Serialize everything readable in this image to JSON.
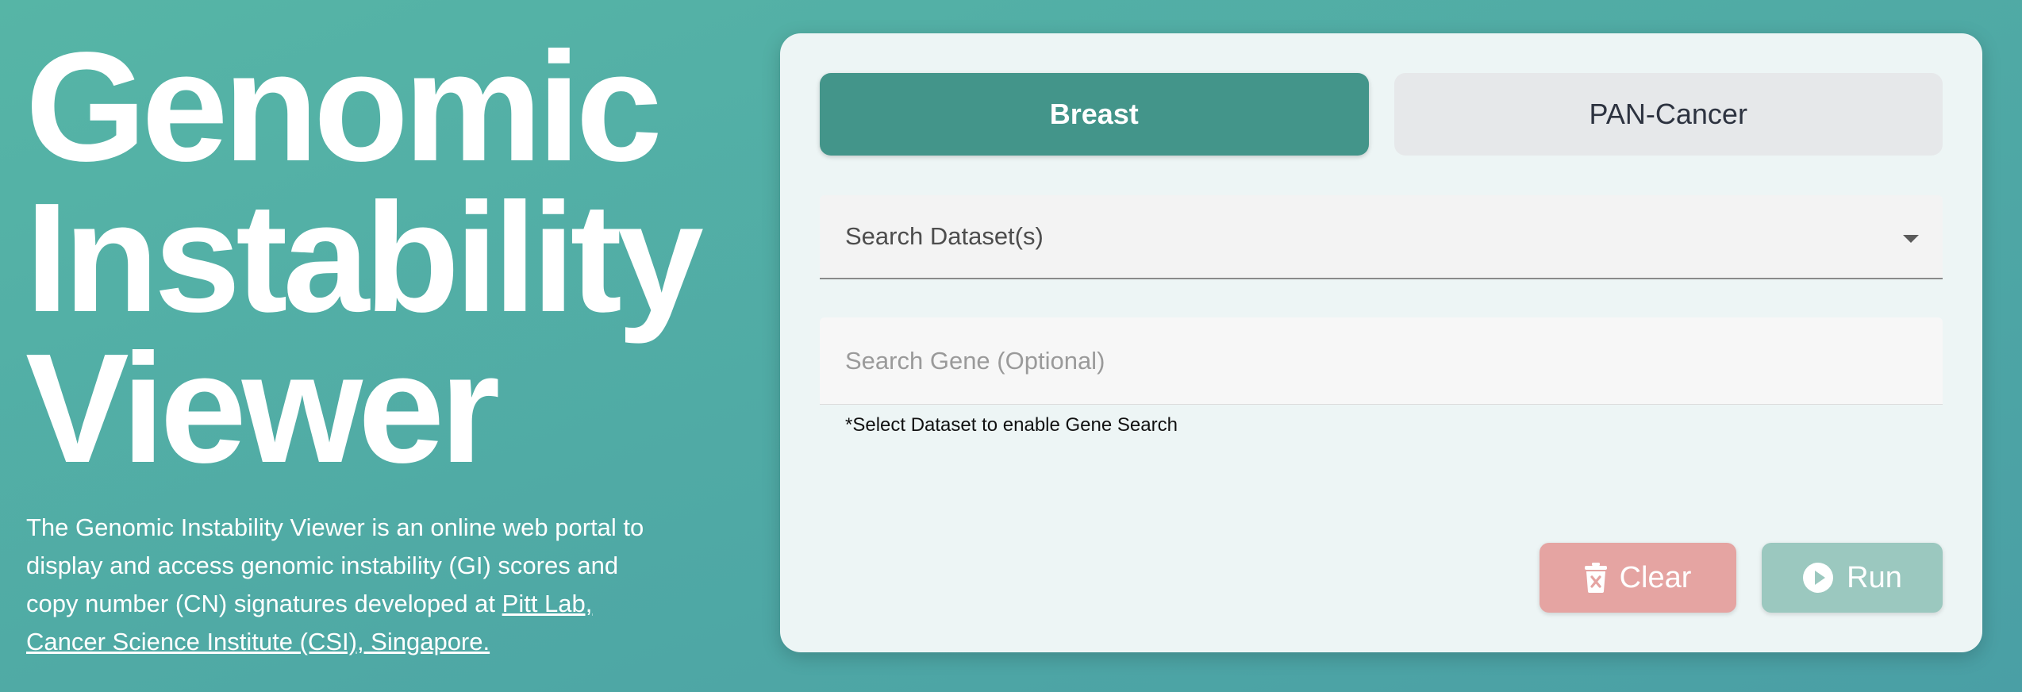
{
  "hero": {
    "title_lines": [
      "Genomic",
      "Instability",
      "Viewer"
    ],
    "description": "The Genomic Instability Viewer is an online web portal to display and access genomic instability (GI) scores and copy number (CN) signatures developed at ",
    "link_text": "Pitt Lab, Cancer Science Institute (CSI), Singapore."
  },
  "tabs": [
    {
      "label": "Breast",
      "active": true
    },
    {
      "label": "PAN-Cancer",
      "active": false
    }
  ],
  "dataset_select": {
    "placeholder": "Search Dataset(s)"
  },
  "gene_search": {
    "placeholder": "Search Gene (Optional)",
    "value": "",
    "helper": "*Select Dataset to enable Gene Search"
  },
  "actions": {
    "clear_label": "Clear",
    "clear_icon": "trash-x-icon",
    "run_label": "Run",
    "run_icon": "play-circle-icon"
  },
  "colors": {
    "background": "#52aea6",
    "active_tab": "#43958a",
    "clear_button": "#e5a4a2",
    "run_button": "#9bc8bf"
  }
}
